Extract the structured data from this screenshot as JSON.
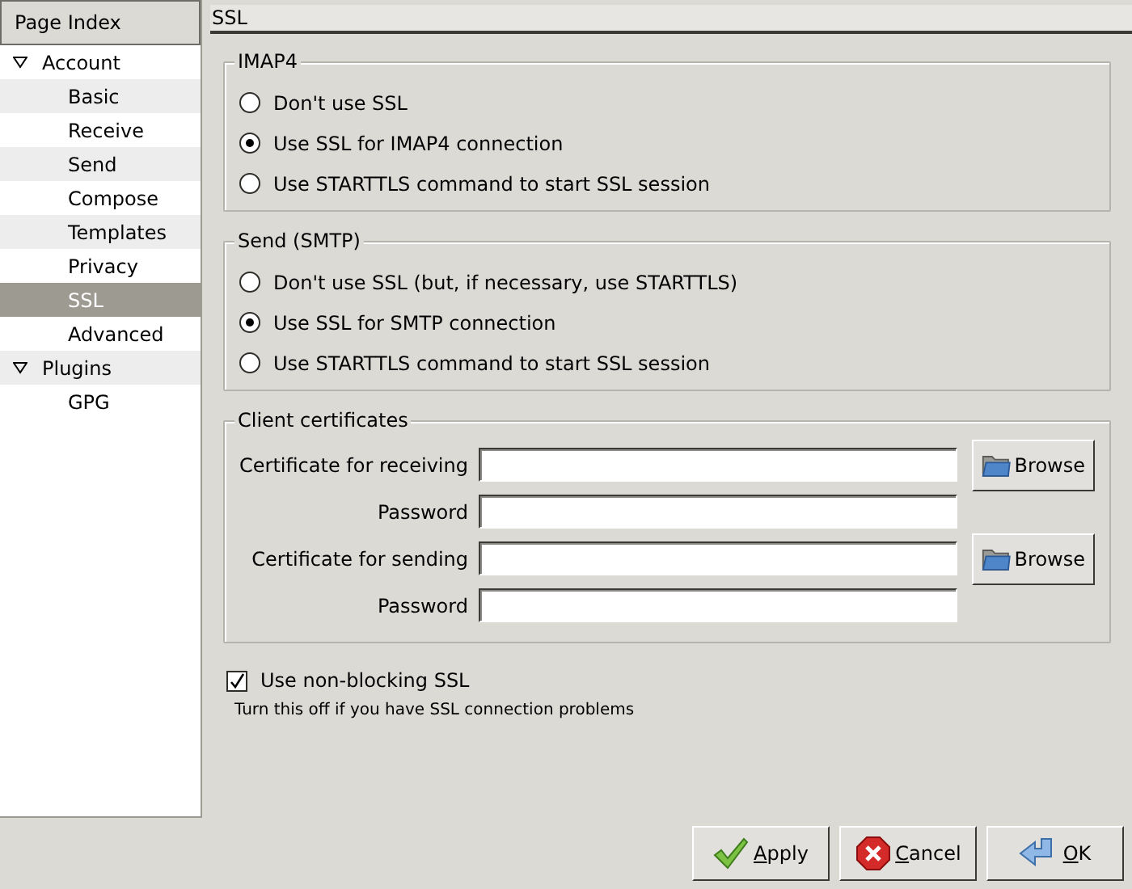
{
  "sidebar": {
    "header": "Page Index",
    "items": [
      {
        "label": "Account",
        "expanded": true,
        "selected": false,
        "children": [
          {
            "label": "Basic",
            "selected": false
          },
          {
            "label": "Receive",
            "selected": false
          },
          {
            "label": "Send",
            "selected": false
          },
          {
            "label": "Compose",
            "selected": false
          },
          {
            "label": "Templates",
            "selected": false
          },
          {
            "label": "Privacy",
            "selected": false
          },
          {
            "label": "SSL",
            "selected": true
          },
          {
            "label": "Advanced",
            "selected": false
          }
        ]
      },
      {
        "label": "Plugins",
        "expanded": true,
        "selected": false,
        "children": [
          {
            "label": "GPG",
            "selected": false
          }
        ]
      }
    ]
  },
  "page_title": "SSL",
  "groups": [
    {
      "kind": "radios",
      "title": "IMAP4",
      "options": [
        {
          "label": "Don't use SSL",
          "selected": false
        },
        {
          "label": "Use SSL for IMAP4 connection",
          "selected": true
        },
        {
          "label": "Use STARTTLS command to start SSL session",
          "selected": false
        }
      ]
    },
    {
      "kind": "radios",
      "title": "Send (SMTP)",
      "options": [
        {
          "label": "Don't use SSL (but, if necessary, use STARTTLS)",
          "selected": false
        },
        {
          "label": "Use SSL for SMTP connection",
          "selected": true
        },
        {
          "label": "Use STARTTLS command to start SSL session",
          "selected": false
        }
      ]
    },
    {
      "kind": "fields",
      "title": "Client certificates",
      "rows": [
        {
          "label": "Certificate for receiving",
          "browse": "Browse"
        },
        {
          "label": "Password"
        },
        {
          "label": "Certificate for sending",
          "browse": "Browse"
        },
        {
          "label": "Password"
        }
      ]
    }
  ],
  "non_blocking": {
    "label": "Use non-blocking SSL",
    "checked": true,
    "hint": "Turn this off if you have SSL connection problems"
  },
  "buttons": [
    {
      "kind": "apply",
      "key": "A",
      "rest": "pply"
    },
    {
      "kind": "cancel",
      "key": "C",
      "rest": "ancel"
    },
    {
      "kind": "ok",
      "key": "O",
      "rest": "K"
    }
  ]
}
